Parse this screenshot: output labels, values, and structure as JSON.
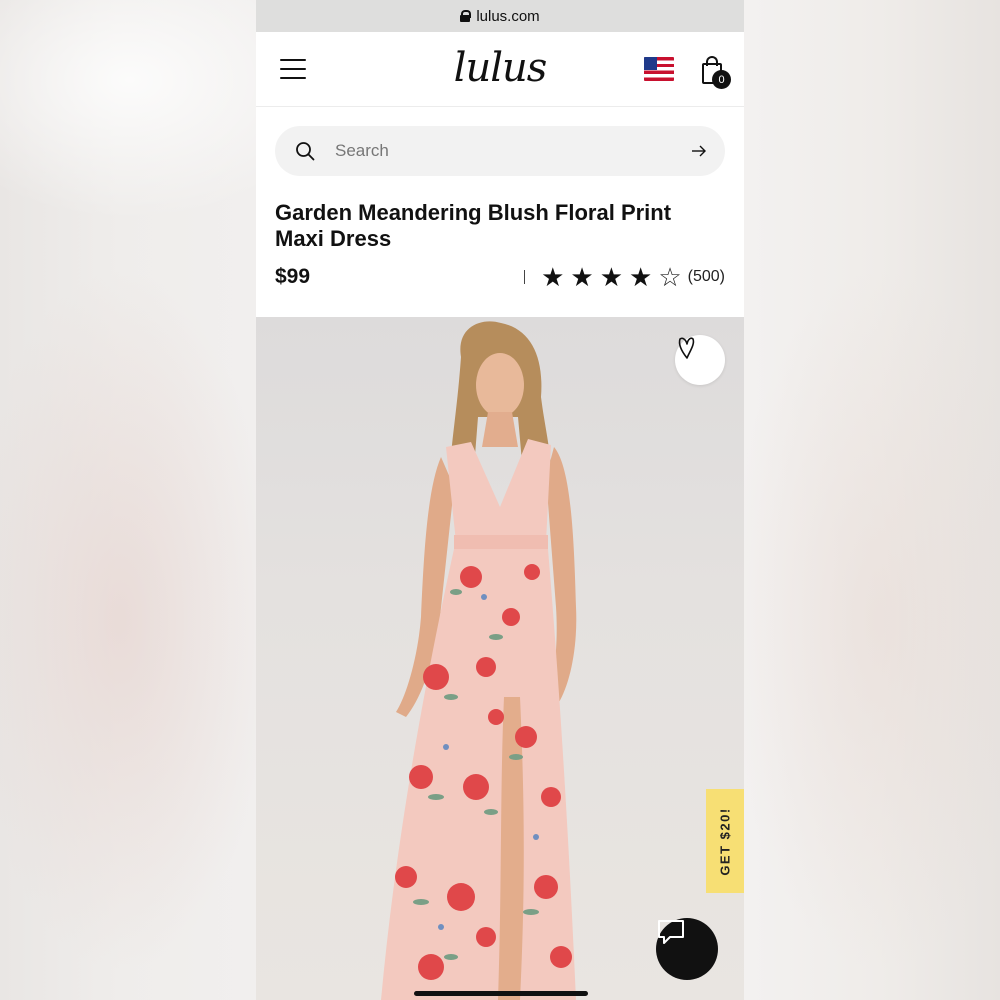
{
  "browser": {
    "url": "lulus.com"
  },
  "header": {
    "logo": "lulus",
    "cart_count": "0",
    "flag": "us-flag-icon"
  },
  "search": {
    "placeholder": "Search"
  },
  "product": {
    "title": "Garden Meandering Blush Floral Print Maxi Dress",
    "price": "$99",
    "rating": {
      "stars": 4,
      "max": 5,
      "count_label": "(500)"
    }
  },
  "promo": {
    "label": "GET $20!"
  },
  "colors": {
    "promo_bg": "#f7df74",
    "dress_blush": "#f3c9bf",
    "floral_red": "#e0484a",
    "text": "#111111"
  },
  "icons": [
    "lock-icon",
    "menu-icon",
    "us-flag-icon",
    "shopping-bag-icon",
    "search-icon",
    "arrow-right-icon",
    "star-icon",
    "heart-icon",
    "chat-icon"
  ]
}
